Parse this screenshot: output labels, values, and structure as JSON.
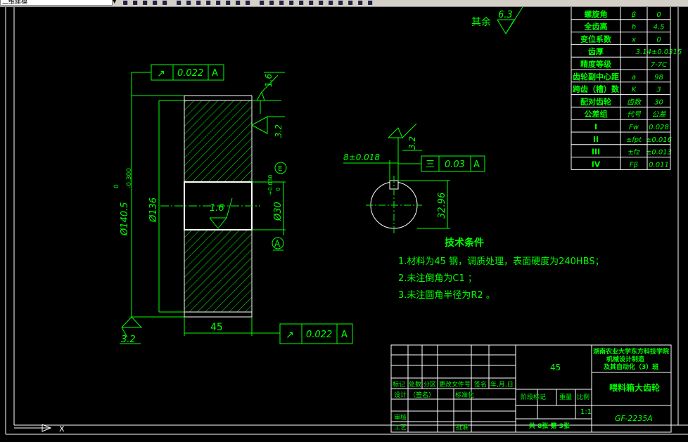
{
  "toolbar": {
    "layer_value": "二维建模",
    "icons": [
      "tb-icon-1",
      "tb-icon-2",
      "tb-icon-3",
      "tb-icon-4",
      "tb-icon-5",
      "tb-icon-6",
      "tb-icon-7",
      "tb-icon-8",
      "tb-icon-9",
      "tb-icon-10",
      "tb-icon-11",
      "tb-icon-12",
      "tb-icon-13",
      "tb-icon-14",
      "tb-icon-15",
      "tb-icon-16",
      "tb-icon-17",
      "tb-icon-18",
      "tb-icon-19",
      "tb-icon-20",
      "tb-icon-21",
      "tb-icon-22",
      "tb-icon-23",
      "tb-icon-24",
      "tb-icon-25"
    ]
  },
  "colors": {
    "line": "#ffffff",
    "dim": "#00ff00",
    "text": "#00ff00",
    "background": "#000000",
    "table": "#ffffff"
  },
  "drawing": {
    "roughness_rest_label": "其余",
    "roughness_rest_value": "6.3",
    "tolerance_top": {
      "symbol": "↗",
      "value": "0.022",
      "datum": "A"
    },
    "tolerance_bottom": {
      "symbol": "↗",
      "value": "0.022",
      "datum": "A"
    },
    "tolerance_key": {
      "symbol": "三",
      "value": "0.03",
      "datum": "A"
    },
    "roughness_top": "1.6",
    "roughness_side": "3.2",
    "roughness_bore": "1.6",
    "roughness_bottom": "3.2",
    "roughness_key": "3.2",
    "dim_outer": "Ø140.5",
    "dim_outer_tol_upper": "0",
    "dim_outer_tol_lower": "-0.300",
    "dim_root": "Ø136",
    "dim_bore": "Ø30",
    "dim_bore_tol_upper": "+0.030",
    "dim_bore_tol_lower": "0",
    "dim_bore_mod": "E",
    "datum_label": "A",
    "dim_width": "45",
    "dim_key_width": "8±0.018",
    "dim_key_depth": "32.96"
  },
  "tech": {
    "title": "技术条件",
    "lines": [
      "1.材料为45 钢，调质处理，表面硬度为240HBS；",
      "2.未注倒角为C1 ；",
      "3.未注圆角半径为R2 。"
    ]
  },
  "params": {
    "rows": [
      [
        "螺旋角",
        "β",
        "0"
      ],
      [
        "全齿高",
        "h",
        "4.5"
      ],
      [
        "变位系数",
        "x",
        "0"
      ],
      [
        "齿厚",
        "",
        "3.14±0.0315"
      ],
      [
        "精度等级",
        "",
        "7-7C"
      ],
      [
        "齿轮副中心距",
        "a",
        "98"
      ],
      [
        "跨齿（槽）数",
        "K",
        "3"
      ],
      [
        "配对齿轮",
        "齿数",
        "30"
      ]
    ],
    "header": [
      "公差组",
      "代号",
      "公差"
    ],
    "groups": [
      [
        "I",
        "Fw",
        "0.028"
      ],
      [
        "II",
        "±fpt",
        "±0.016"
      ],
      [
        "III",
        "±fz",
        "±0.013"
      ],
      [
        "IV",
        "Fβ",
        "0.011"
      ]
    ]
  },
  "title_block": {
    "school": [
      "湖南农业大学东方科技学院",
      "机械设计制造",
      "及其自动化（3）班"
    ],
    "material": "45",
    "part_name": "喂料箱大齿轮",
    "drawing_no": "GF-2235A",
    "scale": "1:1",
    "sheets": "共 8张 第 3张",
    "labels": {
      "mark": "标记",
      "count": "处数",
      "zone": "分区",
      "doc": "更改文件号",
      "sign": "签名",
      "date": "年,月,日",
      "design": "设计",
      "audit1": "（签名）",
      "std": "标准化",
      "stage": "阶段标记",
      "weight": "重量",
      "scale_label": "比例",
      "review": "审核",
      "process": "工艺",
      "approve": "批准"
    }
  },
  "cursor": {
    "label": "X"
  }
}
